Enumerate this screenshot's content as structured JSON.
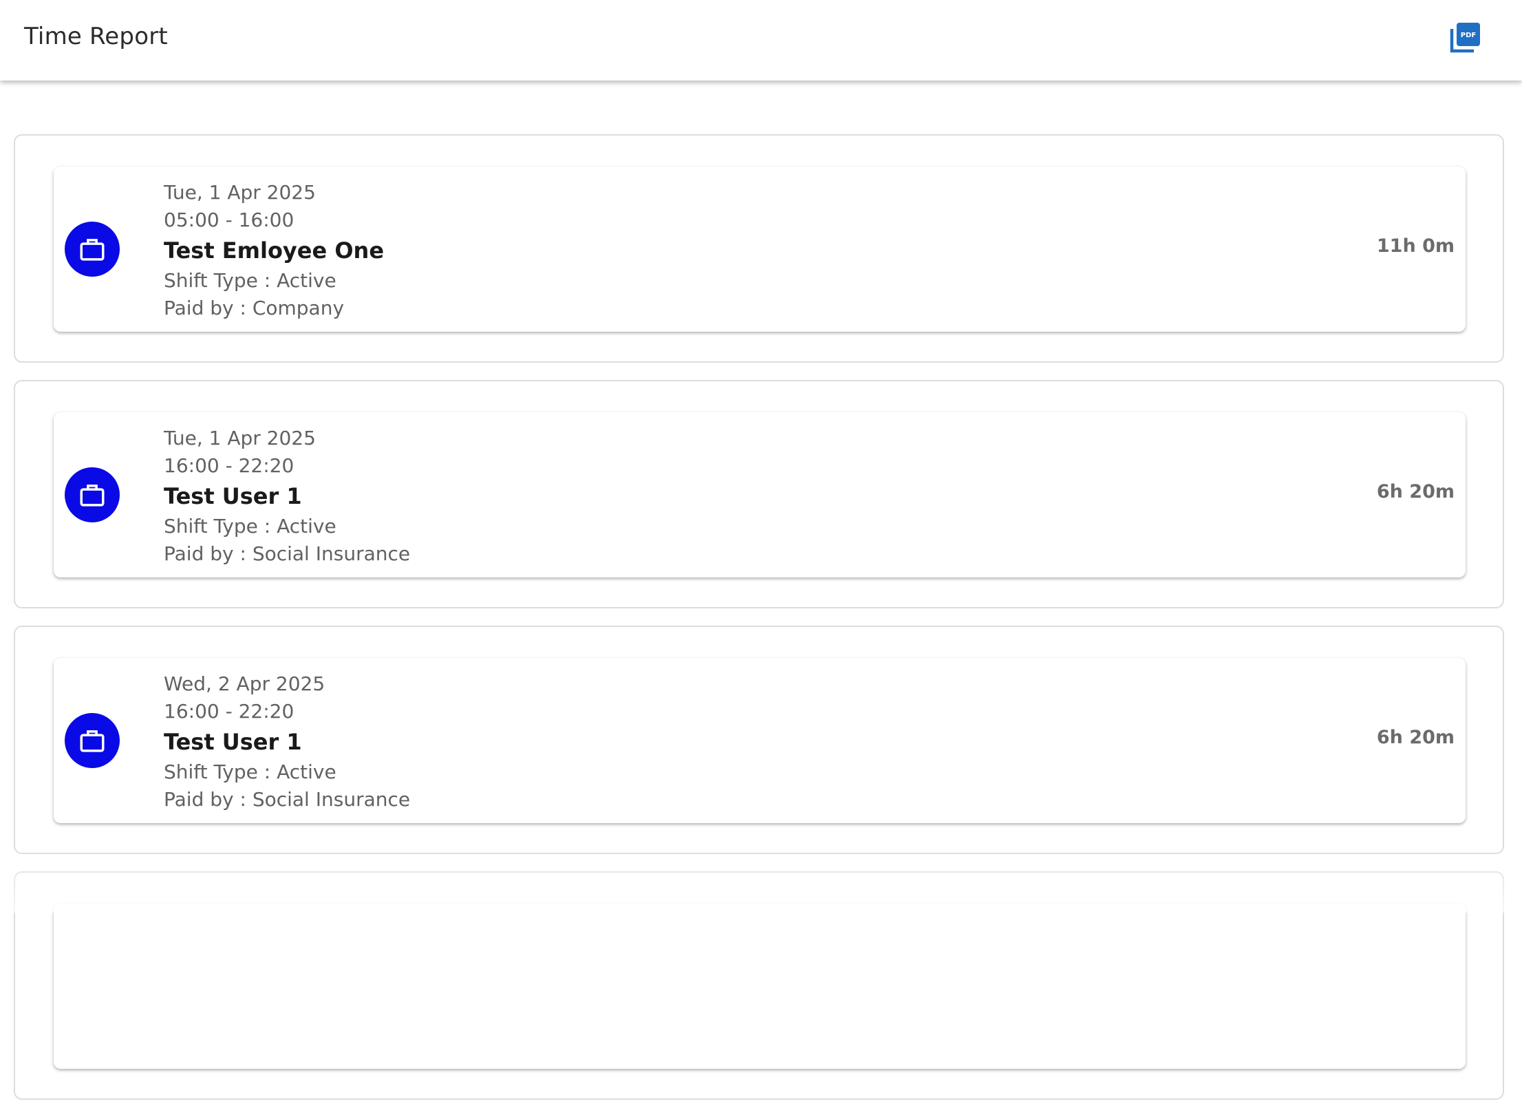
{
  "header": {
    "title": "Time Report",
    "pdf_icon": "pdf-icon"
  },
  "shifts": [
    {
      "date": "Tue, 1 Apr 2025",
      "time": "05:00 - 16:00",
      "name": "Test Emloyee One",
      "shift_type": "Shift Type : Active",
      "paid_by": "Paid by : Company",
      "duration": "11h 0m",
      "icon": "briefcase-icon"
    },
    {
      "date": "Tue, 1 Apr 2025",
      "time": "16:00 - 22:20",
      "name": "Test User 1",
      "shift_type": "Shift Type : Active",
      "paid_by": "Paid by : Social Insurance",
      "duration": "6h 20m",
      "icon": "briefcase-icon"
    },
    {
      "date": "Wed, 2 Apr 2025",
      "time": "16:00 - 22:20",
      "name": "Test User 1",
      "shift_type": "Shift Type : Active",
      "paid_by": "Paid by : Social Insurance",
      "duration": "6h 20m",
      "icon": "briefcase-icon"
    }
  ],
  "colors": {
    "accent": "#0a0ae6",
    "pdf_icon": "#1f6fc5"
  }
}
